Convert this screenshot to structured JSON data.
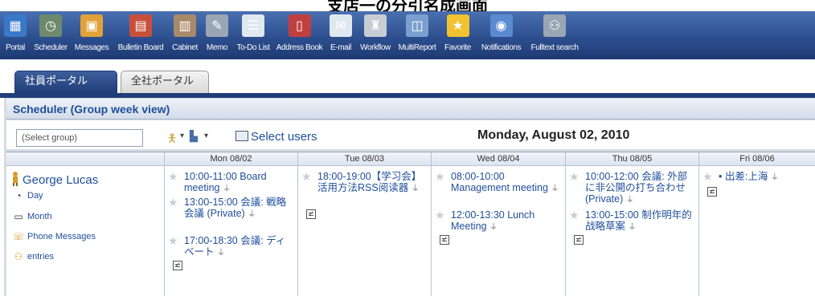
{
  "caption": "支店一の分引名成画面",
  "toolbar": [
    {
      "label": "Portal",
      "icon": "portal-icon",
      "color": "#3a78c9",
      "glyph": "▦"
    },
    {
      "label": "Scheduler",
      "icon": "clock-icon",
      "color": "#6d8a6d",
      "glyph": "◷"
    },
    {
      "label": "Messages",
      "icon": "messages-icon",
      "color": "#e0a23a",
      "glyph": "▣"
    },
    {
      "label": "Bulletin Board",
      "icon": "bulletin-board-icon",
      "color": "#c8503a",
      "glyph": "▤"
    },
    {
      "label": "Cabinet",
      "icon": "cabinet-icon",
      "color": "#a88a6a",
      "glyph": "▥"
    },
    {
      "label": "Memo",
      "icon": "memo-icon",
      "color": "#9aa6b5",
      "glyph": "✎"
    },
    {
      "label": "To-Do List",
      "icon": "todo-icon",
      "color": "#dfe7f0",
      "glyph": "☰"
    },
    {
      "label": "Address Book",
      "icon": "address-book-icon",
      "color": "#c04040",
      "glyph": "▯"
    },
    {
      "label": "E-mail",
      "icon": "email-icon",
      "color": "#dfe7f0",
      "glyph": "✉"
    },
    {
      "label": "Workflow",
      "icon": "workflow-icon",
      "color": "#c8ccd3",
      "glyph": "♜"
    },
    {
      "label": "MultiReport",
      "icon": "multireport-icon",
      "color": "#7aa0d0",
      "glyph": "◫"
    },
    {
      "label": "Favorite",
      "icon": "star-icon",
      "color": "#f2c230",
      "glyph": "★"
    },
    {
      "label": "Notifications",
      "icon": "notifications-icon",
      "color": "#5a8bd0",
      "glyph": "◉"
    },
    {
      "label": "Fulltext search",
      "icon": "binoculars-icon",
      "color": "#9aa6b5",
      "glyph": "⚇"
    }
  ],
  "tabs": [
    {
      "label": "社員ポータル",
      "active": true
    },
    {
      "label": "全社ポータル",
      "active": false
    }
  ],
  "panel_title": "Scheduler (Group week view)",
  "controls": {
    "group_select": "(Select group)",
    "select_users": "Select users",
    "current_date": "Monday, August 02, 2010"
  },
  "days": [
    "Mon 08/02",
    "Tue 08/03",
    "Wed 08/04",
    "Thu 08/05",
    "Fri 08/06"
  ],
  "user": {
    "name": "George Lucas",
    "links": [
      "Day",
      "Month",
      "Phone Messages",
      "entries"
    ]
  },
  "events": [
    [
      {
        "text": "10:00-11:00 Board meeting"
      },
      {
        "text": "13:00-15:00 会議: 戦略会議 (Private)"
      },
      {
        "text": "17:00-18:30 会議: ディベート"
      }
    ],
    [
      {
        "text": "18:00-19:00【学习会】活用方法RSS阅读器"
      }
    ],
    [
      {
        "text": "08:00-10:00 Management meeting"
      },
      {
        "text": "12:00-13:30 Lunch Meeting"
      }
    ],
    [
      {
        "text": "10:00-12:00 会議: 外部に非公開の打ち合わせ (Private)"
      },
      {
        "text": "13:00-15:00 制作明年的战略草案"
      }
    ],
    [
      {
        "text": "• 出差:上海"
      }
    ]
  ]
}
